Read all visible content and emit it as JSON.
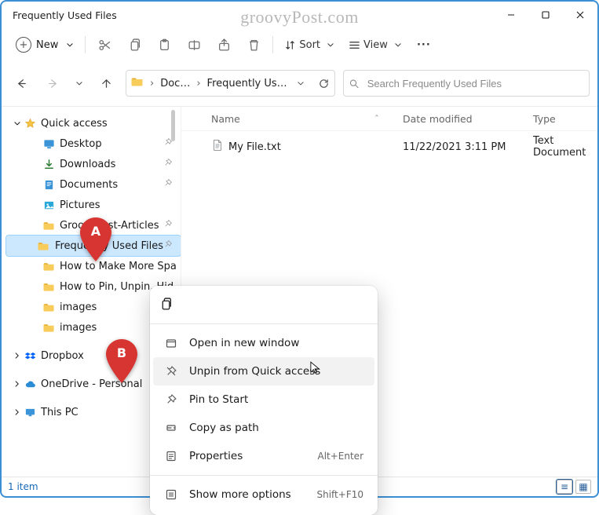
{
  "watermark": "groovyPost.com",
  "window": {
    "title": "Frequently Used Files"
  },
  "cmdbar": {
    "new_label": "New",
    "sort_label": "Sort",
    "view_label": "View"
  },
  "icons": {
    "cut": "scissors-icon",
    "copy": "copy-icon",
    "paste": "clipboard-icon",
    "rename": "rename-icon",
    "share": "share-icon",
    "delete": "trash-icon",
    "more": "ellipsis-icon"
  },
  "breadcrumb": {
    "segments": [
      "Doc…",
      "Frequently Us…"
    ]
  },
  "search": {
    "placeholder": "Search Frequently Used Files",
    "value": ""
  },
  "columns": {
    "name": "Name",
    "date": "Date modified",
    "type": "Type"
  },
  "files": [
    {
      "name": "My File.txt",
      "date": "11/22/2021 3:11 PM",
      "type": "Text Document"
    }
  ],
  "sidebar": {
    "quick_access_label": "Quick access",
    "items": [
      {
        "label": "Desktop",
        "icon": "desktop"
      },
      {
        "label": "Downloads",
        "icon": "downloads"
      },
      {
        "label": "Documents",
        "icon": "documents"
      },
      {
        "label": "Pictures",
        "icon": "pictures"
      },
      {
        "label": "GroovyPost-Articles",
        "icon": "folder"
      },
      {
        "label": "Frequently Used Files",
        "icon": "folder",
        "selected": true
      },
      {
        "label": "How to Make More Spa",
        "icon": "folder"
      },
      {
        "label": "How to Pin, Unpin, Hid",
        "icon": "folder"
      },
      {
        "label": "images",
        "icon": "folder"
      },
      {
        "label": "images",
        "icon": "folder"
      }
    ],
    "dropbox_label": "Dropbox",
    "onedrive_label": "OneDrive - Personal",
    "thispc_label": "This PC"
  },
  "context_menu": {
    "items": [
      {
        "label": "Open in new window",
        "icon": "new-window-icon"
      },
      {
        "label": "Unpin from Quick access",
        "icon": "unpin-icon",
        "hover": true
      },
      {
        "label": "Pin to Start",
        "icon": "pin-icon"
      },
      {
        "label": "Copy as path",
        "icon": "copy-path-icon"
      },
      {
        "label": "Properties",
        "icon": "properties-icon",
        "shortcut": "Alt+Enter"
      },
      {
        "label": "Show more options",
        "icon": "more-options-icon",
        "shortcut": "Shift+F10",
        "separated": true
      }
    ]
  },
  "status": {
    "count_label": "1 item"
  },
  "markers": {
    "a": "A",
    "b": "B"
  }
}
